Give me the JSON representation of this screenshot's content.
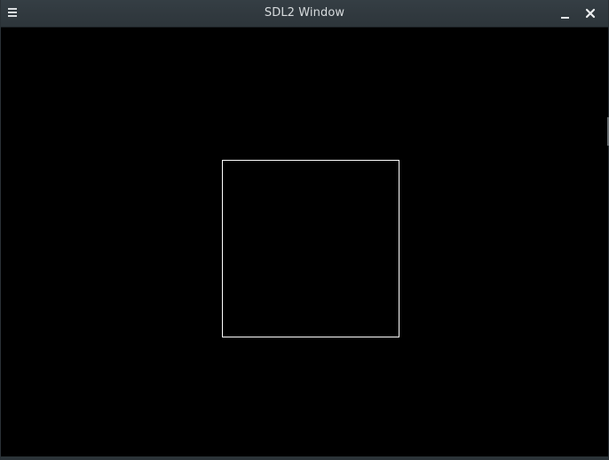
{
  "window": {
    "title": "SDL2 Window"
  },
  "titlebar": {
    "menu_icon": "hamburger-menu-icon",
    "minimize_icon": "minimize-icon",
    "close_icon": "close-icon"
  },
  "colors": {
    "titlebar_background": "#323a3f",
    "title_text": "#d7dbdd",
    "canvas_background": "#000000",
    "square_outline": "#ffffff"
  }
}
